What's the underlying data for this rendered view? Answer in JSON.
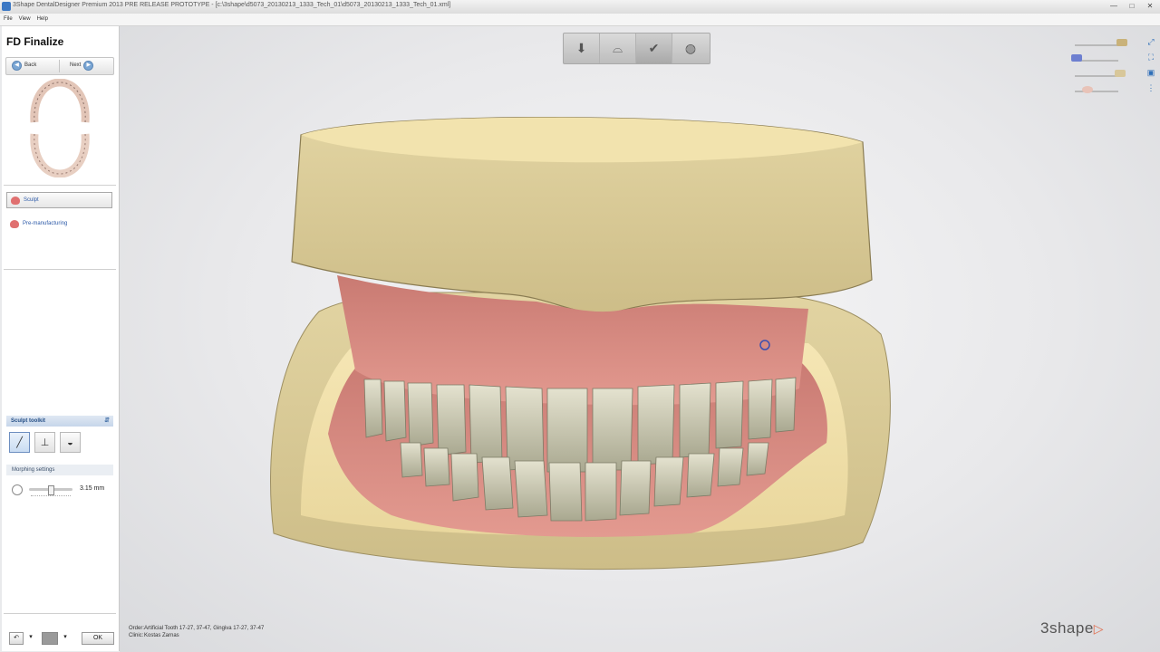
{
  "window": {
    "title": "3Shape DentalDesigner Premium 2013 PRE RELEASE PROTOTYPE - [c:\\3shape\\d5073_20130213_1333_Tech_01\\d5073_20130213_1333_Tech_01.xml]",
    "controls": [
      "minimize-icon",
      "maximize-icon",
      "close-icon"
    ]
  },
  "menu": [
    "File",
    "View",
    "Help"
  ],
  "sidebar": {
    "wizard_title": "FD Finalize",
    "back_label": "Back",
    "next_label": "Next",
    "steps": [
      {
        "label": "Sculpt",
        "icon": "tooth-icon",
        "active": true
      },
      {
        "label": "Pre-manufacturing",
        "icon": "tooth-icon",
        "active": false
      }
    ],
    "toolkit": {
      "title": "Sculpt toolkit",
      "pin_label": "⇵",
      "tools": [
        {
          "name": "brush-tool",
          "glyph": "╱"
        },
        {
          "name": "smooth-tool",
          "glyph": "⊥"
        },
        {
          "name": "shape-tool",
          "glyph": "◒"
        }
      ],
      "morphing_settings_label": "Morphing settings",
      "slider_value_fraction": 0.5,
      "radius_value": "3.15 mm"
    },
    "bottom": {
      "ok_label": "OK"
    }
  },
  "viewport": {
    "top_tools": [
      {
        "name": "model-tool",
        "glyph": "⬇",
        "active": false
      },
      {
        "name": "bridge-tool",
        "glyph": "⌓",
        "active": false
      },
      {
        "name": "tooth-check-tool",
        "glyph": "✔",
        "active": true
      },
      {
        "name": "disc-tool",
        "glyph": "◍",
        "active": false
      }
    ],
    "order_key": "Order:",
    "order_value": "Artificial Tooth 17-27, 37-47, Gingiva 17-27, 37-47",
    "clinic_key": "Clinic:",
    "clinic_value": "Kostas Zarnas",
    "brand": "3shape",
    "brand_mark": "▷",
    "colors": {
      "stone": "#e6d9a6",
      "gingiva": "#d98b82",
      "teeth": "#c9c8b4",
      "accent": "#2d5aa8"
    }
  }
}
